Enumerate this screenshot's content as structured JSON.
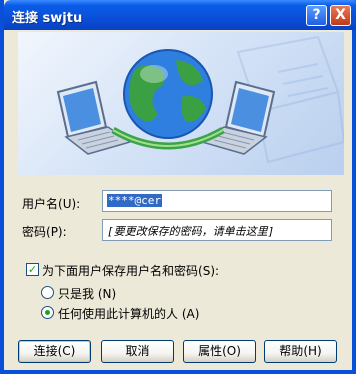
{
  "window": {
    "title": "连接 swjtu"
  },
  "titlebar": {
    "help_glyph": "?",
    "close_glyph": "X"
  },
  "form": {
    "username_label": "用户名",
    "username_key": "(U):",
    "username_value": "****@cer",
    "password_label": "密码",
    "password_key": "(P):",
    "password_placeholder": "[要更改保存的密码，请单击这里]"
  },
  "save": {
    "label": "为下面用户保存用户名和密码",
    "key": "(S):",
    "checked": true,
    "options": [
      {
        "label": "只是我",
        "key": "(N)",
        "selected": false
      },
      {
        "label": "任何使用此计算机的人",
        "key": "(A)",
        "selected": true
      }
    ]
  },
  "buttons": {
    "connect": "连接",
    "connect_key": "(C)",
    "cancel": "取消",
    "properties": "属性",
    "properties_key": "(O)",
    "help": "帮助",
    "help_key": "(H)"
  },
  "colors": {
    "title_blue": "#0a4fd8",
    "dialog_bg": "#ece9d8",
    "selection": "#316ac5",
    "check_green": "#21a121"
  }
}
